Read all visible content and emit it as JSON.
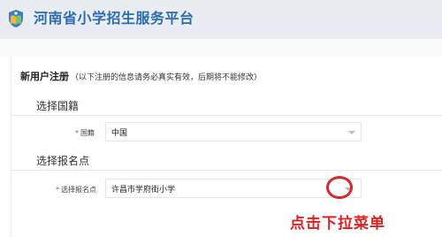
{
  "header": {
    "site_title": "河南省小学招生服务平台",
    "logo_icon": "book-shield-logo-icon"
  },
  "form": {
    "title": "新用户注册",
    "note": "（以下注册的信息请务必真实有效，后期将不能修改）",
    "sections": [
      {
        "label": "选择国籍"
      },
      {
        "label": "选择报名点"
      }
    ],
    "nationality": {
      "label": "国籍",
      "required_mark": "*",
      "value": "中国",
      "icon": "chevron-down-icon"
    },
    "registration_point": {
      "label": "选择报名点",
      "required_mark": "*",
      "value": "许昌市学府街小学",
      "icon": "chevron-down-icon"
    }
  },
  "annotation": {
    "text": "点击下拉菜单",
    "color": "#e02020"
  },
  "colors": {
    "brand": "#2b6cb0",
    "header_bg": "#e9edf2",
    "highlight_ring": "#d42a2a"
  }
}
